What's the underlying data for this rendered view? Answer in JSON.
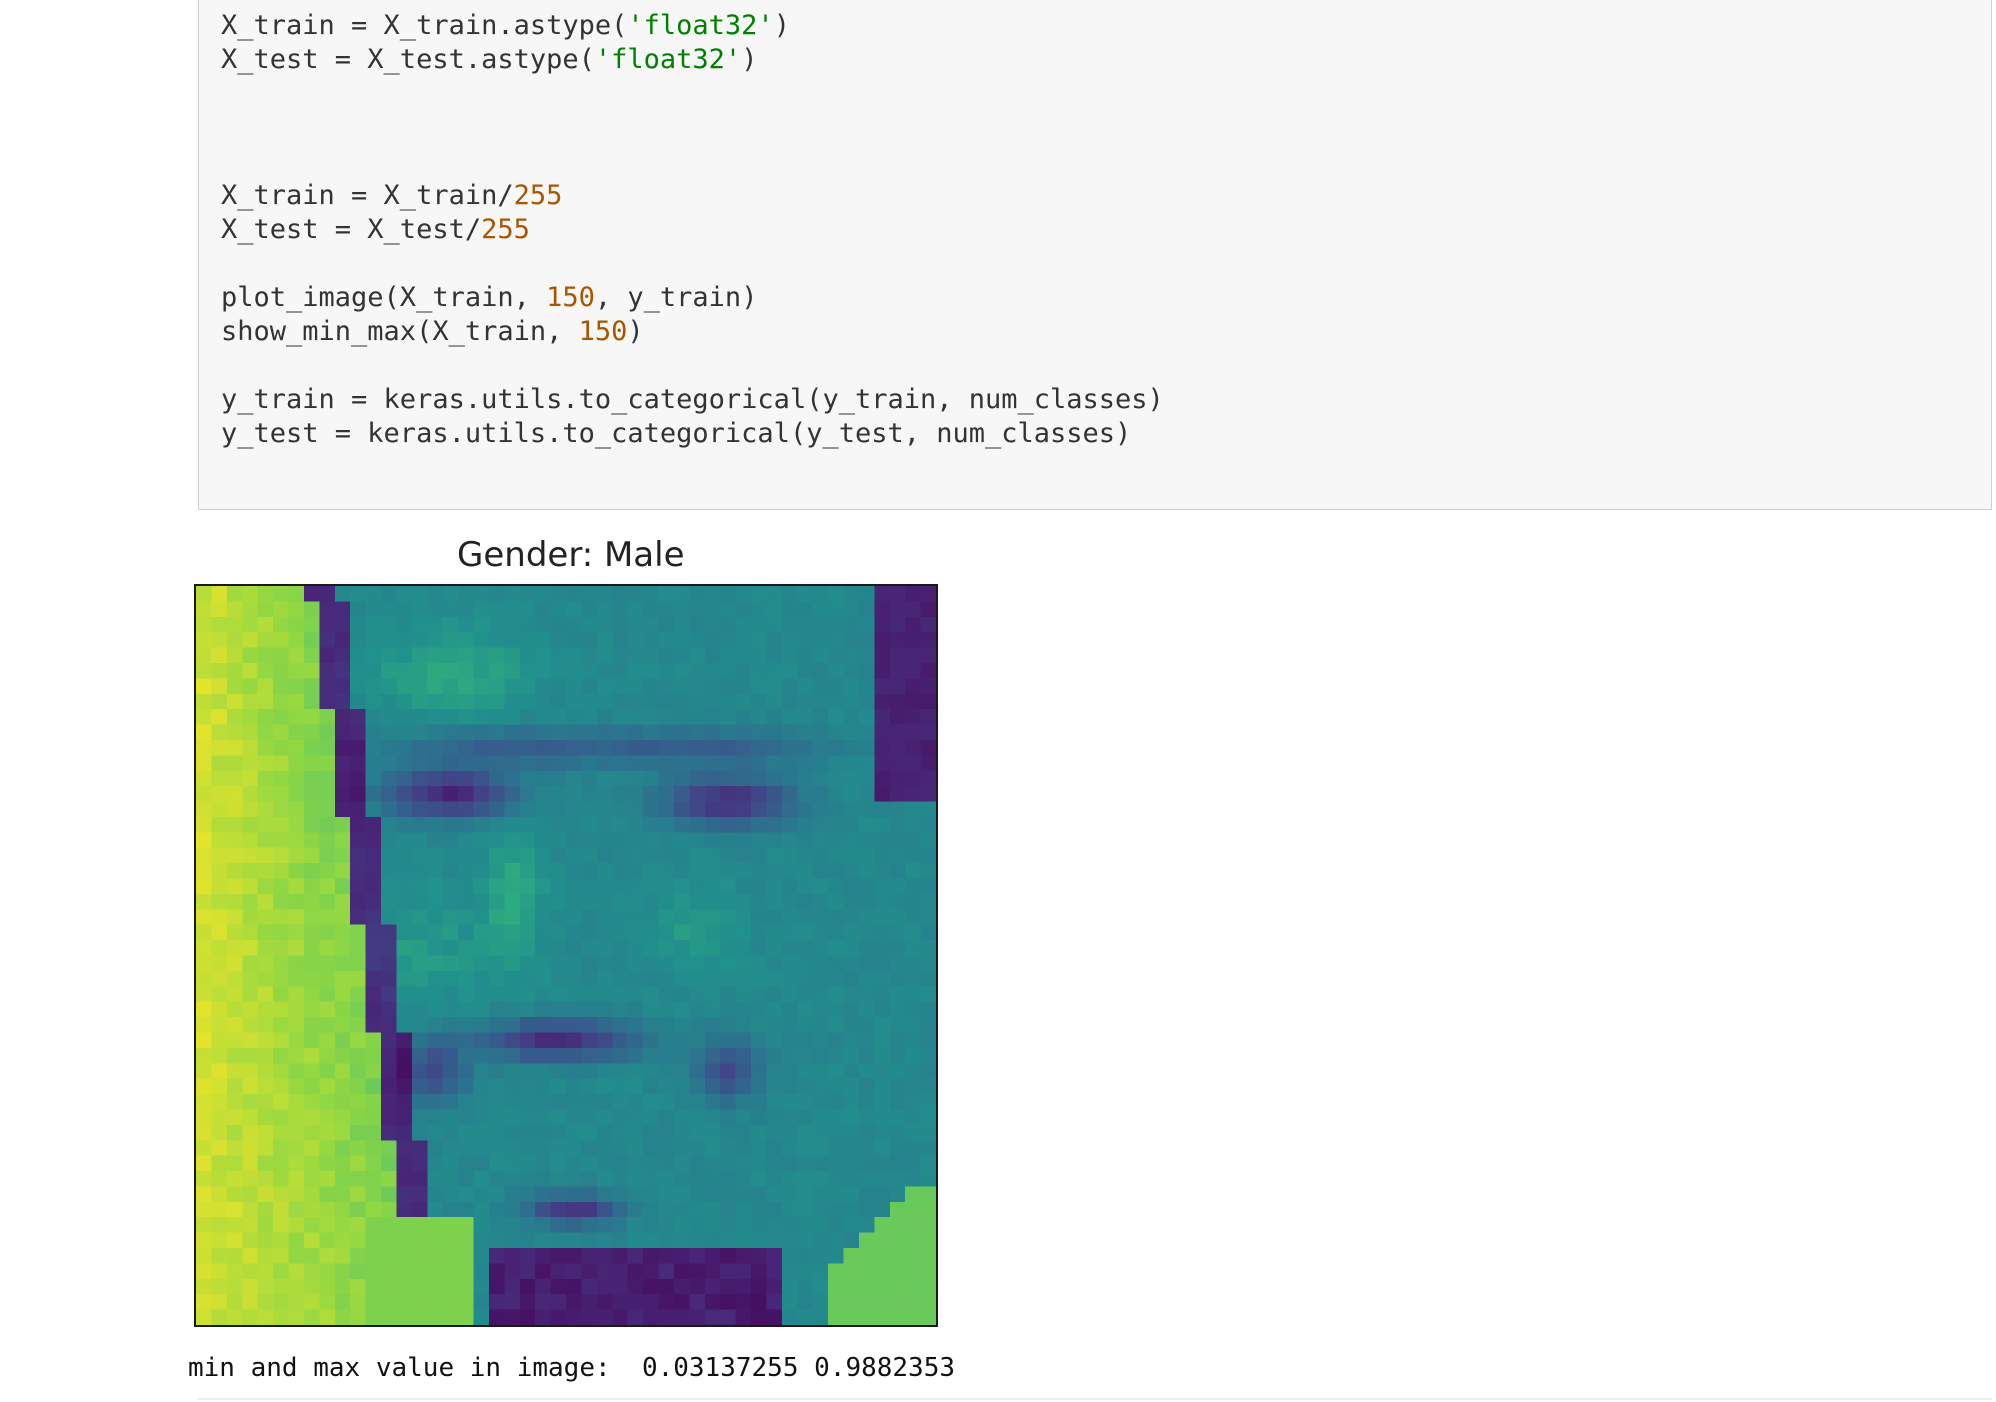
{
  "code_cell": {
    "lines": [
      [
        {
          "t": "X_train = X_train.astype("
        },
        {
          "t": "'float32'",
          "k": "str"
        },
        {
          "t": ")"
        }
      ],
      [
        {
          "t": "X_test = X_test.astype("
        },
        {
          "t": "'float32'",
          "k": "str"
        },
        {
          "t": ")"
        }
      ],
      [],
      [],
      [],
      [
        {
          "t": "X_train = X_train/"
        },
        {
          "t": "255",
          "k": "num"
        }
      ],
      [
        {
          "t": "X_test = X_test/"
        },
        {
          "t": "255",
          "k": "num"
        }
      ],
      [],
      [
        {
          "t": "plot_image(X_train, "
        },
        {
          "t": "150",
          "k": "num"
        },
        {
          "t": ", y_train)"
        }
      ],
      [
        {
          "t": "show_min_max(X_train, "
        },
        {
          "t": "150",
          "k": "num"
        },
        {
          "t": ")"
        }
      ],
      [],
      [
        {
          "t": "y_train = keras.utils.to_categorical(y_train, num_classes)"
        }
      ],
      [
        {
          "t": "y_test = keras.utils.to_categorical(y_test, num_classes)"
        }
      ]
    ]
  },
  "output": {
    "plot_title": "Gender: Male",
    "stdout": "min and max value in image:  0.03137255 0.9882353",
    "image_colormap": "viridis",
    "image_grid_size": 48
  },
  "colors": {
    "string": "#008000",
    "number": "#aa5500",
    "code_text": "#333333",
    "cell_background": "#f7f7f7",
    "cell_border": "#cfcfcf"
  }
}
